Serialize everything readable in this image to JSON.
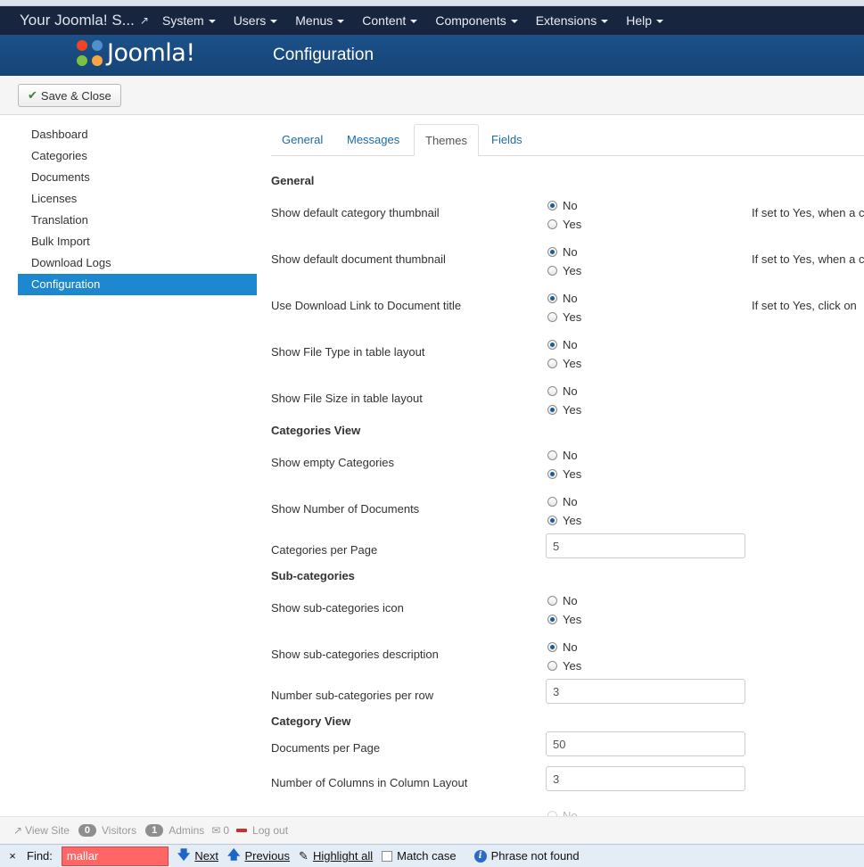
{
  "navbar": {
    "site_title": "Your Joomla! S...",
    "external_icon": "external-link-icon",
    "menus": [
      "System",
      "Users",
      "Menus",
      "Content",
      "Components",
      "Extensions",
      "Help"
    ]
  },
  "header": {
    "logo_text": "Joomla!",
    "title": "Configuration"
  },
  "toolbar": {
    "save_close_label": "Save & Close",
    "save_icon": "check-icon"
  },
  "sidebar": {
    "items": [
      "Dashboard",
      "Categories",
      "Documents",
      "Licenses",
      "Translation",
      "Bulk Import",
      "Download Logs",
      "Configuration"
    ],
    "active": "Configuration"
  },
  "tabs": {
    "items": [
      "General",
      "Messages",
      "Themes",
      "Fields"
    ],
    "active": "Themes"
  },
  "form": {
    "sections": {
      "general": "General",
      "categories_view": "Categories View",
      "sub_categories": "Sub-categories",
      "category_view": "Category View"
    },
    "option_no": "No",
    "option_yes": "Yes",
    "fields": {
      "show_default_category_thumbnail": {
        "label": "Show default category thumbnail",
        "value": "No",
        "help": "If set to Yes, when a c"
      },
      "show_default_document_thumbnail": {
        "label": "Show default document thumbnail",
        "value": "No",
        "help": "If set to Yes, when a c"
      },
      "use_download_link": {
        "label": "Use Download Link to Document title",
        "value": "No",
        "help": "If set to Yes, click on"
      },
      "show_file_type": {
        "label": "Show File Type in table layout",
        "value": "No"
      },
      "show_file_size": {
        "label": "Show File Size in table layout",
        "value": "Yes"
      },
      "show_empty_categories": {
        "label": "Show empty Categories",
        "value": "Yes"
      },
      "show_number_documents": {
        "label": "Show Number of Documents",
        "value": "Yes"
      },
      "categories_per_page": {
        "label": "Categories per Page",
        "value": "5"
      },
      "show_subcategories_icon": {
        "label": "Show sub-categories icon",
        "value": "Yes"
      },
      "show_subcategories_description": {
        "label": "Show sub-categories description",
        "value": "No"
      },
      "subcategories_per_row": {
        "label": "Number sub-categories per row",
        "value": "3"
      },
      "documents_per_page": {
        "label": "Documents per Page",
        "value": "50"
      },
      "columns_in_layout": {
        "label": "Number of Columns in Column Layout",
        "value": "3"
      },
      "partial_next_option": "No"
    }
  },
  "statusbar": {
    "view_site": "View Site",
    "visitors_count": "0",
    "visitors_label": "Visitors",
    "admins_count": "1",
    "admins_label": "Admins",
    "messages_count": "0",
    "logout": "Log out"
  },
  "findbar": {
    "close": "×",
    "label": "Find:",
    "query": "mallar",
    "next": "Next",
    "previous": "Previous",
    "highlight_all": "Highlight all",
    "match_case": "Match case",
    "status": "Phrase not found"
  }
}
